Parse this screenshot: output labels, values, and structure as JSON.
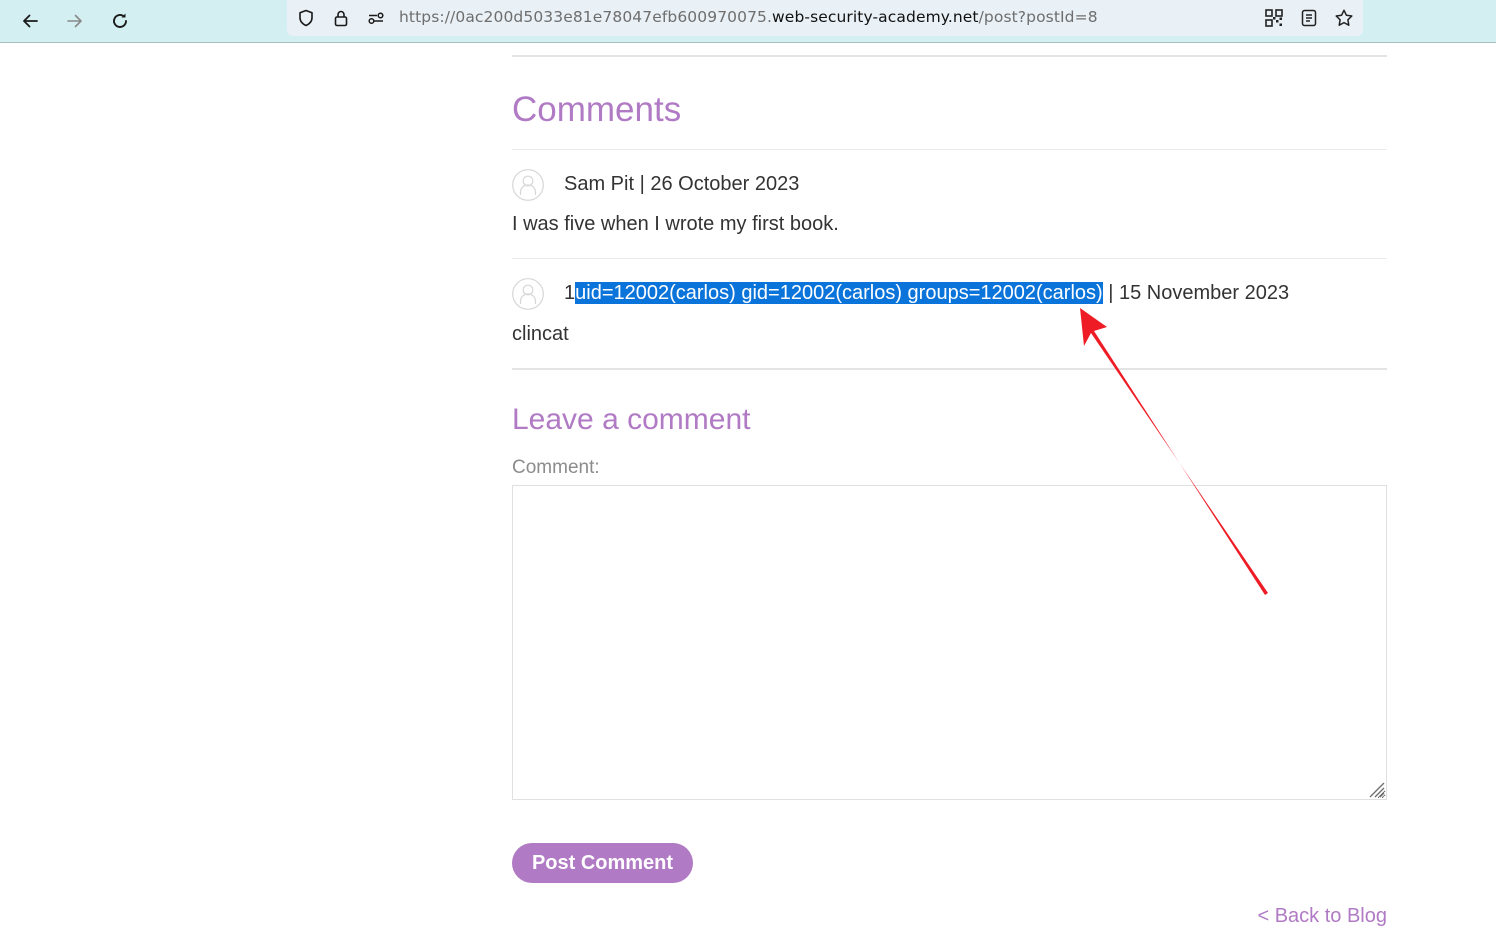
{
  "browser": {
    "url_prefix": "https://0ac200d5033e81e78047efb600970075.",
    "url_host": "web-security-academy.net",
    "url_path": "/post?postId=8",
    "icons": {
      "back": "arrow-left-icon",
      "forward": "arrow-right-icon",
      "reload": "reload-icon",
      "shield": "shield-icon",
      "lock": "lock-icon",
      "permissions": "permissions-icon",
      "qr": "qr-code-icon",
      "reader": "reader-view-icon",
      "bookmark": "star-icon"
    }
  },
  "comments_section": {
    "title": "Comments",
    "comments": [
      {
        "author": "Sam Pit",
        "separator": " | ",
        "date": "26 October 2023",
        "body": "I was five when I wrote my first book."
      },
      {
        "author_prefix": "1",
        "author_selected": "uid=12002(carlos) gid=12002(carlos) groups=12002(carlos)",
        "separator": " | ",
        "date": "15 November 2023",
        "body": "clincat"
      }
    ]
  },
  "leave_comment": {
    "title": "Leave a comment",
    "comment_label": "Comment:",
    "comment_value": "",
    "submit_label": "Post Comment"
  },
  "footer": {
    "back_link": "< Back to Blog"
  },
  "colors": {
    "accent": "#b07ac4",
    "selection": "#0a74da",
    "annotation_arrow": "#ee1c25"
  }
}
